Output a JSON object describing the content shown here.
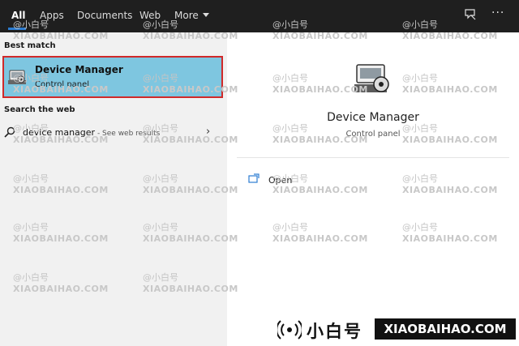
{
  "tabs": [
    {
      "label": "All",
      "active": true
    },
    {
      "label": "Apps"
    },
    {
      "label": "Documents"
    },
    {
      "label": "Web"
    },
    {
      "label": "More"
    }
  ],
  "topbar": {
    "feedback_icon": "feedback-icon",
    "more_icon": "ellipsis-icon"
  },
  "left": {
    "best_match_heading": "Best match",
    "best_match": {
      "title": "Device Manager",
      "subtitle": "Control panel",
      "icon": "device-manager-icon"
    },
    "search_web_heading": "Search the web",
    "web_result": {
      "query": "device manager",
      "hint": " - See web results",
      "icon": "search-icon"
    }
  },
  "right": {
    "app_name": "Device Manager",
    "app_type": "Control panel",
    "actions": [
      {
        "label": "Open",
        "icon": "open-icon"
      }
    ]
  },
  "watermark": {
    "cn": "@小白号",
    "en": "XIAOBAIHAO.COM"
  },
  "banner": {
    "cn": "小白号",
    "en": "XIAOBAIHAO.COM"
  },
  "colors": {
    "topbar": "#1f1f1f",
    "highlight": "#7ec6e0",
    "highlight_border": "#d02a2a",
    "left_panel": "#f1f1f1"
  }
}
